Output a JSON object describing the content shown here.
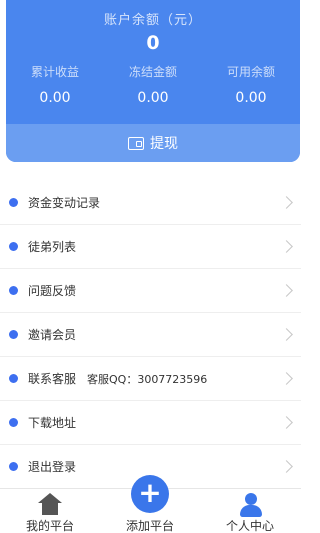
{
  "balance": {
    "title": "账户余额（元）",
    "amount": "0",
    "stats": [
      {
        "label": "累计收益",
        "value": "0.00"
      },
      {
        "label": "冻结金额",
        "value": "0.00"
      },
      {
        "label": "可用余额",
        "value": "0.00"
      }
    ],
    "withdraw_label": "提现",
    "withdraw_icon": "wallet-icon"
  },
  "colors": {
    "accent": "#4a86ee",
    "dot": "#3d6ff0"
  },
  "menu": [
    {
      "label": "资金变动记录"
    },
    {
      "label": "徒弟列表"
    },
    {
      "label": "问题反馈"
    },
    {
      "label": "邀请会员"
    },
    {
      "label": "联系客服",
      "extra": "客服QQ：3007723596"
    },
    {
      "label": "下载地址"
    },
    {
      "label": "退出登录"
    }
  ],
  "tabbar": {
    "home": {
      "label": "我的平台",
      "icon": "home-icon"
    },
    "add": {
      "label": "添加平台",
      "icon": "plus-icon",
      "symbol": "+"
    },
    "me": {
      "label": "个人中心",
      "icon": "user-icon"
    }
  }
}
